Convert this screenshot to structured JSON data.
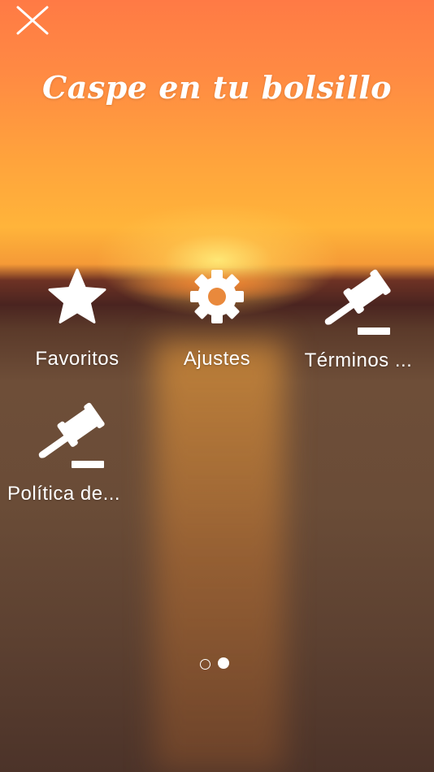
{
  "header": {
    "title": "Caspe en tu bolsillo",
    "close_icon": "close-icon"
  },
  "menu": {
    "items": [
      {
        "label": "Favoritos",
        "icon": "star-icon"
      },
      {
        "label": "Ajustes",
        "icon": "gear-icon"
      },
      {
        "label": "Términos ...",
        "icon": "gavel-icon"
      },
      {
        "label": "Política de...",
        "icon": "gavel-icon"
      }
    ]
  },
  "pager": {
    "pages": 2,
    "current": 2
  },
  "colors": {
    "sky_top": "#ff7a45",
    "sky_mid": "#ffb43a",
    "horizon": "#4a2420",
    "water": "#6a4c37",
    "text": "#ffffff"
  }
}
